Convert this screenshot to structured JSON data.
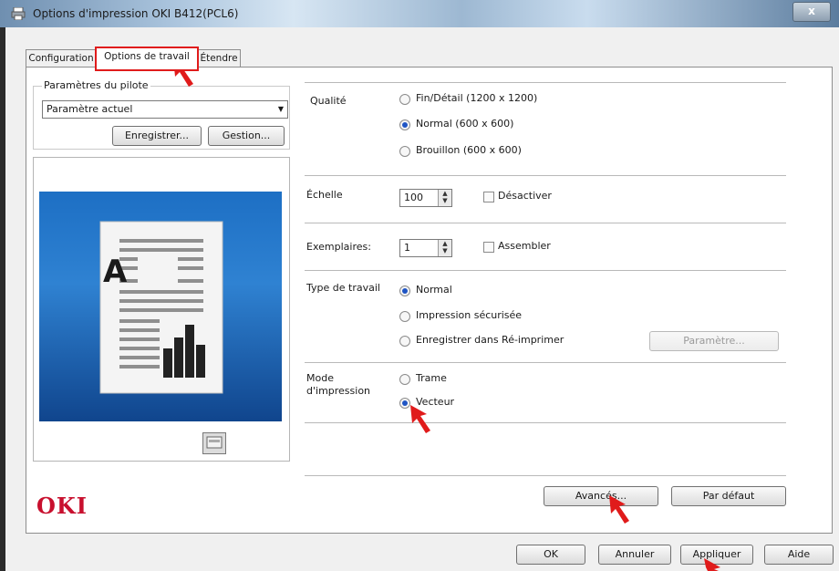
{
  "window": {
    "title": "Options d'impression OKI B412(PCL6)",
    "close_label": "x"
  },
  "tabs": [
    {
      "label": "Configuration"
    },
    {
      "label": "Options de travail"
    },
    {
      "label": "Étendre"
    }
  ],
  "driver_settings": {
    "group_label": "Paramètres du pilote",
    "select_value": "Paramètre actuel",
    "save_label": "Enregistrer...",
    "manage_label": "Gestion..."
  },
  "preview": {
    "letter": "A"
  },
  "quality": {
    "label": "Qualité",
    "options": [
      "Fin/Détail (1200 x 1200)",
      "Normal (600 x 600)",
      "Brouillon (600 x 600)"
    ],
    "selected": "Normal (600 x 600)"
  },
  "scale": {
    "label": "Échelle",
    "value": "100",
    "disable_label": "Désactiver",
    "disable_checked": false
  },
  "copies": {
    "label": "Exemplaires:",
    "value": "1",
    "collate_label": "Assembler",
    "collate_checked": false
  },
  "job_type": {
    "label": "Type de travail",
    "options": [
      "Normal",
      "Impression sécurisée",
      "Enregistrer dans Ré-imprimer"
    ],
    "selected": "Normal",
    "settings_label": "Paramètre..."
  },
  "print_mode": {
    "label_line1": "Mode",
    "label_line2": "d'impression",
    "options": [
      "Trame",
      "Vecteur"
    ],
    "selected": "Vecteur"
  },
  "brand": {
    "logo_text": "OKI"
  },
  "buttons": {
    "advanced": "Avancés...",
    "default": "Par défaut",
    "ok": "OK",
    "cancel": "Annuler",
    "apply": "Appliquer",
    "help": "Aide"
  },
  "colors": {
    "highlight": "#e01b1b",
    "radio_selected": "#1f55c4",
    "logo": "#c8102e"
  }
}
